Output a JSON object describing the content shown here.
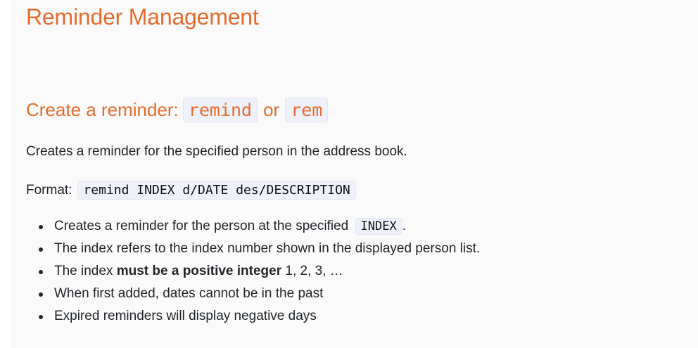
{
  "page_title": "Reminder Management",
  "section": {
    "heading_prefix": "Create a reminder:",
    "command_primary": "remind",
    "heading_or": "or",
    "command_alias": "rem"
  },
  "description": "Creates a reminder for the specified person in the address book.",
  "format": {
    "label": "Format:",
    "code": "remind INDEX d/DATE des/DESCRIPTION"
  },
  "bullets": {
    "b1_text": "Creates a reminder for the person at the specified",
    "b1_code": "INDEX",
    "b1_suffix": ".",
    "b2": "The index refers to the index number shown in the displayed person list.",
    "b3_prefix": "The index",
    "b3_bold": "must be a positive integer",
    "b3_suffix": "1, 2, 3, …",
    "b4": "When first added, dates cannot be in the past",
    "b5": "Expired reminders will display negative days"
  },
  "colors": {
    "heading": "#e46c2e",
    "body_text": "#212529",
    "code_bg": "#eef1fa",
    "page_bg": "#fafafa"
  }
}
